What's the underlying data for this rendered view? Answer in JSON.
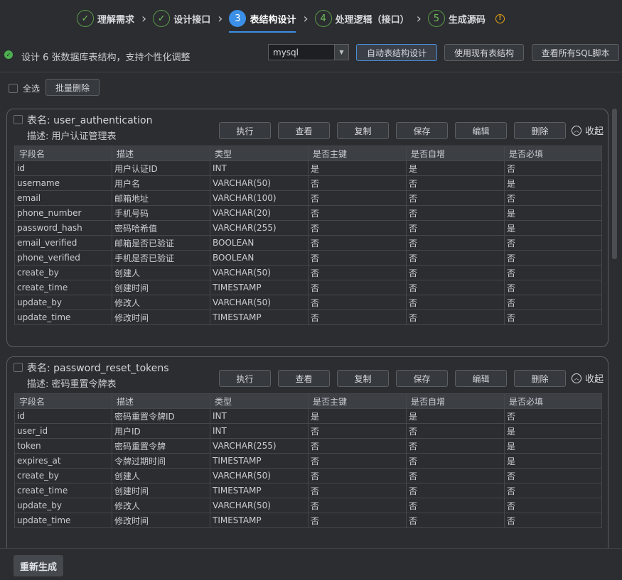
{
  "steps": [
    {
      "num": "✓",
      "label": "理解需求",
      "state": "done"
    },
    {
      "num": "✓",
      "label": "设计接口",
      "state": "done"
    },
    {
      "num": "3",
      "label": "表结构设计",
      "state": "active"
    },
    {
      "num": "4",
      "label": "处理逻辑（接口）",
      "state": "todo"
    },
    {
      "num": "5",
      "label": "生成源码",
      "state": "todo"
    }
  ],
  "toolbar": {
    "status": "设计 6 张数据库表结构，支持个性化调整",
    "db_value": "mysql",
    "auto_design": "自动表结构设计",
    "use_existing": "使用现有表结构",
    "view_sql": "查看所有SQL脚本"
  },
  "bulk": {
    "select_all": "全选",
    "batch_delete": "批量删除"
  },
  "card_actions": {
    "execute": "执行",
    "view": "查看",
    "copy": "复制",
    "save": "保存",
    "edit": "编辑",
    "delete": "删除",
    "collapse": "收起"
  },
  "columns": [
    "字段名",
    "描述",
    "类型",
    "是否主键",
    "是否自增",
    "是否必填"
  ],
  "tables": [
    {
      "name_label": "表名: user_authentication",
      "desc_label": "描述: 用户认证管理表",
      "rows": [
        [
          "id",
          "用户认证ID",
          "INT",
          "是",
          "是",
          "否"
        ],
        [
          "username",
          "用户名",
          "VARCHAR(50)",
          "否",
          "否",
          "是"
        ],
        [
          "email",
          "邮箱地址",
          "VARCHAR(100)",
          "否",
          "否",
          "否"
        ],
        [
          "phone_number",
          "手机号码",
          "VARCHAR(20)",
          "否",
          "否",
          "是"
        ],
        [
          "password_hash",
          "密码哈希值",
          "VARCHAR(255)",
          "否",
          "否",
          "是"
        ],
        [
          "email_verified",
          "邮箱是否已验证",
          "BOOLEAN",
          "否",
          "否",
          "否"
        ],
        [
          "phone_verified",
          "手机是否已验证",
          "BOOLEAN",
          "否",
          "否",
          "否"
        ],
        [
          "create_by",
          "创建人",
          "VARCHAR(50)",
          "否",
          "否",
          "否"
        ],
        [
          "create_time",
          "创建时间",
          "TIMESTAMP",
          "否",
          "否",
          "否"
        ],
        [
          "update_by",
          "修改人",
          "VARCHAR(50)",
          "否",
          "否",
          "否"
        ],
        [
          "update_time",
          "修改时间",
          "TIMESTAMP",
          "否",
          "否",
          "否"
        ]
      ]
    },
    {
      "name_label": "表名: password_reset_tokens",
      "desc_label": "描述: 密码重置令牌表",
      "rows": [
        [
          "id",
          "密码重置令牌ID",
          "INT",
          "是",
          "是",
          "否"
        ],
        [
          "user_id",
          "用户ID",
          "INT",
          "否",
          "否",
          "是"
        ],
        [
          "token",
          "密码重置令牌",
          "VARCHAR(255)",
          "否",
          "否",
          "是"
        ],
        [
          "expires_at",
          "令牌过期时间",
          "TIMESTAMP",
          "否",
          "否",
          "是"
        ],
        [
          "create_by",
          "创建人",
          "VARCHAR(50)",
          "否",
          "否",
          "否"
        ],
        [
          "create_time",
          "创建时间",
          "TIMESTAMP",
          "否",
          "否",
          "否"
        ],
        [
          "update_by",
          "修改人",
          "VARCHAR(50)",
          "否",
          "否",
          "否"
        ],
        [
          "update_time",
          "修改时间",
          "TIMESTAMP",
          "否",
          "否",
          "否"
        ]
      ]
    }
  ],
  "footer": {
    "regenerate": "重新生成"
  }
}
